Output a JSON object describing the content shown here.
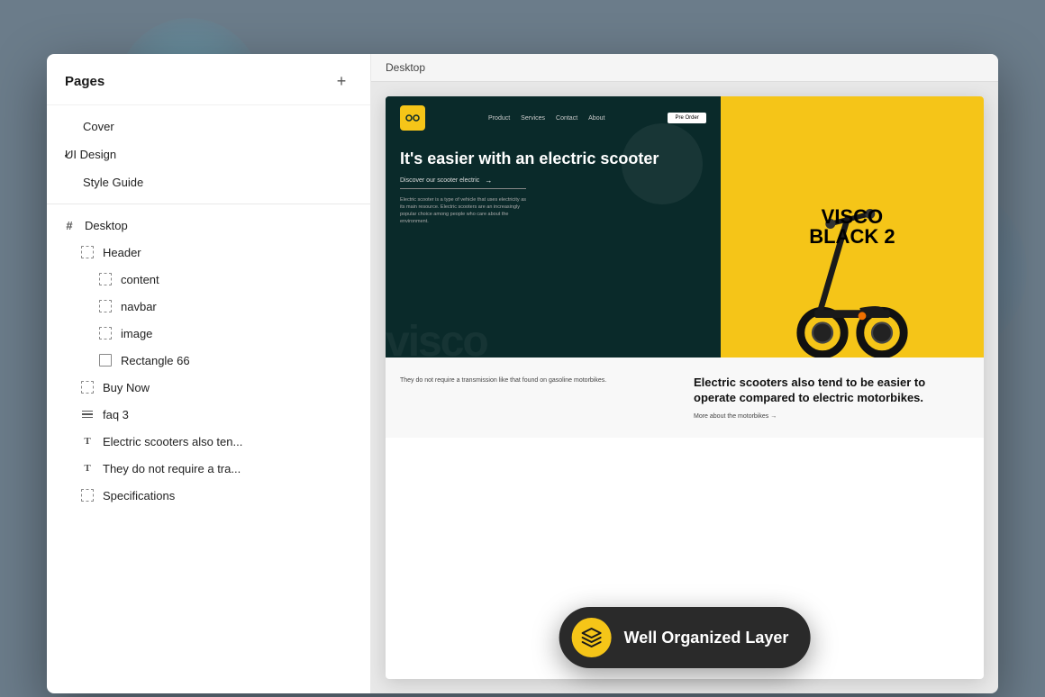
{
  "background": {
    "color": "#6b7c8a"
  },
  "sidebar": {
    "pages_label": "Pages",
    "add_button_label": "+",
    "pages": [
      {
        "id": "cover",
        "label": "Cover",
        "active": false,
        "check": false
      },
      {
        "id": "ui-design",
        "label": "UI Design",
        "active": true,
        "check": true
      },
      {
        "id": "style-guide",
        "label": "Style Guide",
        "active": false,
        "check": false
      }
    ],
    "layers": [
      {
        "id": "desktop",
        "label": "Desktop",
        "level": 0,
        "icon": "hash"
      },
      {
        "id": "header",
        "label": "Header",
        "level": 1,
        "icon": "frame-dashed"
      },
      {
        "id": "content",
        "label": "content",
        "level": 2,
        "icon": "frame-dashed"
      },
      {
        "id": "navbar",
        "label": "navbar",
        "level": 2,
        "icon": "frame-dashed"
      },
      {
        "id": "image",
        "label": "image",
        "level": 2,
        "icon": "frame-dashed"
      },
      {
        "id": "rectangle66",
        "label": "Rectangle 66",
        "level": 2,
        "icon": "frame-solid"
      },
      {
        "id": "buy-now",
        "label": "Buy Now",
        "level": 1,
        "icon": "frame-dashed"
      },
      {
        "id": "faq3",
        "label": "faq 3",
        "level": 1,
        "icon": "bars"
      },
      {
        "id": "electric-text",
        "label": "Electric scooters also ten...",
        "level": 1,
        "icon": "text"
      },
      {
        "id": "they-text",
        "label": "They do not require a tra...",
        "level": 1,
        "icon": "text"
      },
      {
        "id": "specifications",
        "label": "Specifications",
        "level": 1,
        "icon": "frame-dashed"
      }
    ]
  },
  "canvas": {
    "label": "Desktop"
  },
  "preview": {
    "navbar": {
      "logo_text": "oo",
      "links": [
        "Product",
        "Services",
        "Contact",
        "About"
      ],
      "preorder_label": "Pre Order"
    },
    "hero": {
      "title": "It's easier with an electric scooter",
      "discover_label": "Discover our scooter electric",
      "description": "Electric scooter is a type of vehicle that uses electricity as its main resource. Electric scooters are an increasingly popular choice among people who care about the environment.",
      "brand_name": "VISCO\nBLACK 2",
      "bg_text": "visco"
    },
    "lower": {
      "left_text": "They do not require a transmission like that found on gasoline motorbikes.",
      "right_title": "Electric scooters also tend to be easier to operate compared to electric motorbikes.",
      "more_link": "More about the motorbikes →"
    }
  },
  "toast": {
    "icon": "🏷",
    "label": "Well Organized Layer"
  }
}
